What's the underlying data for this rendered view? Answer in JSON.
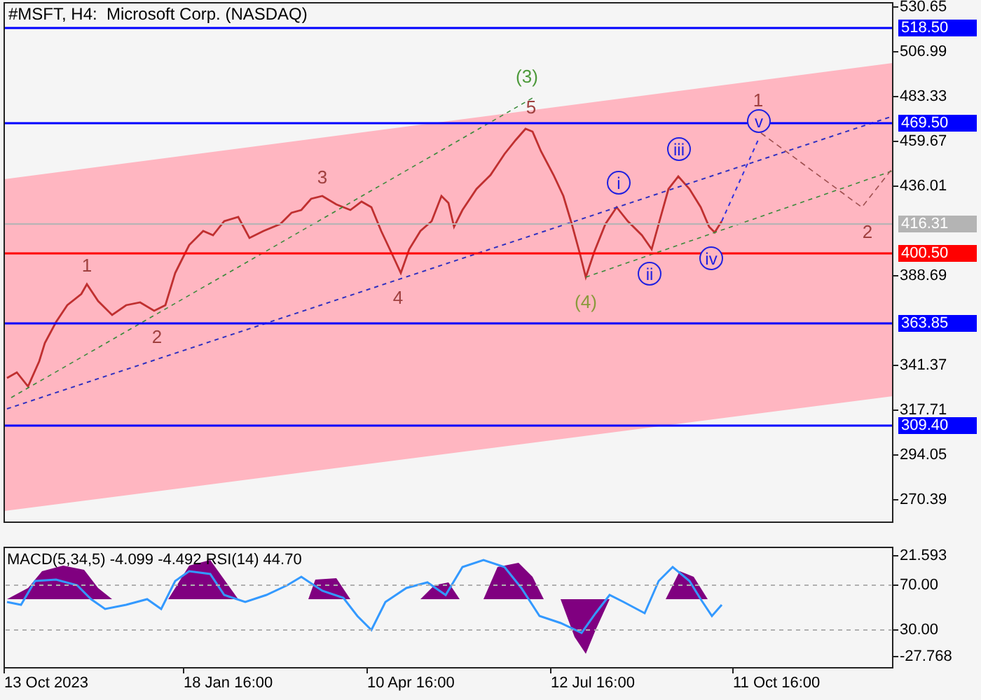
{
  "title": "#MSFT, H4:  Microsoft Corp. (NASDAQ)",
  "price_axis": {
    "ticks": [
      "530.65",
      "506.99",
      "483.33",
      "459.67",
      "436.01",
      "388.69",
      "341.37",
      "317.71",
      "294.05",
      "270.39"
    ]
  },
  "levels": [
    {
      "label": "518.50",
      "color": "#0000ff"
    },
    {
      "label": "469.50",
      "color": "#0000ff"
    },
    {
      "label": "416.31",
      "color": "#b4b4b4"
    },
    {
      "label": "400.50",
      "color": "#ff0000"
    },
    {
      "label": "363.85",
      "color": "#0000ff"
    },
    {
      "label": "309.40",
      "color": "#0000ff"
    }
  ],
  "wave_labels": [
    {
      "text": "1",
      "kind": "plain",
      "color": "#a0403f"
    },
    {
      "text": "2",
      "kind": "plain",
      "color": "#a0403f"
    },
    {
      "text": "3",
      "kind": "plain",
      "color": "#a0403f"
    },
    {
      "text": "4",
      "kind": "plain",
      "color": "#a0403f"
    },
    {
      "text": "5",
      "kind": "plain",
      "color": "#a0403f"
    },
    {
      "text": "(3)",
      "kind": "plain",
      "color": "#4e9a3c"
    },
    {
      "text": "(4)",
      "kind": "plain",
      "color": "#8a9a3c"
    },
    {
      "text": "i",
      "kind": "circled",
      "color": "#2020e0"
    },
    {
      "text": "ii",
      "kind": "circled",
      "color": "#2020e0"
    },
    {
      "text": "iii",
      "kind": "circled",
      "color": "#2020e0"
    },
    {
      "text": "iv",
      "kind": "circled",
      "color": "#2020e0"
    },
    {
      "text": "v",
      "kind": "circled",
      "color": "#2020e0"
    },
    {
      "text": "1",
      "kind": "plain",
      "color": "#a0403f"
    },
    {
      "text": "2",
      "kind": "plain",
      "color": "#a0403f"
    }
  ],
  "indicator": {
    "label": "MACD(5,34,5) -4.099 -4.492 RSI(14) 44.70",
    "ticks": [
      "21.593",
      "70.00",
      "30.00",
      "-27.768"
    ]
  },
  "time_axis": {
    "labels": [
      "13 Oct 2023",
      "18 Jan 16:00",
      "10 Apr 16:00",
      "12 Jul 16:00",
      "11 Oct 16:00"
    ]
  }
}
